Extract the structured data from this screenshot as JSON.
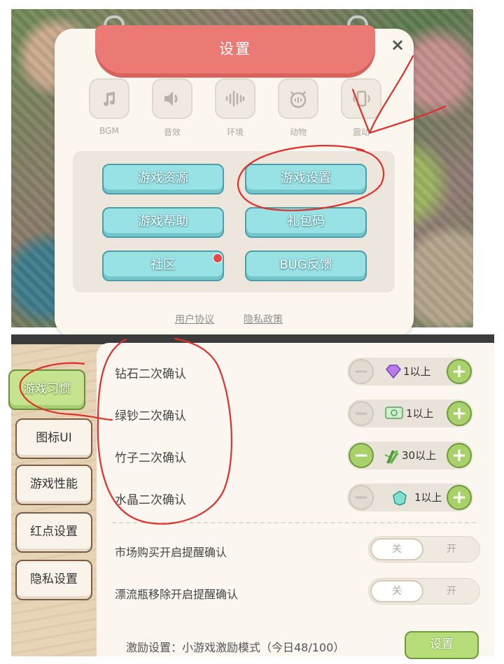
{
  "settings_dialog": {
    "title": "设置",
    "close_label": "×",
    "audio_toggles": [
      {
        "label": "BGM",
        "icon": "music-note-icon"
      },
      {
        "label": "音效",
        "icon": "speaker-icon"
      },
      {
        "label": "环境",
        "icon": "soundwave-icon"
      },
      {
        "label": "动物",
        "icon": "animal-sound-icon"
      },
      {
        "label": "震动",
        "icon": "vibrate-icon"
      }
    ],
    "menu_buttons": {
      "resources": "游戏资源",
      "settings": "游戏设置",
      "help": "游戏帮助",
      "gift_code": "礼包码",
      "community": "社区",
      "bug_feedback": "BUG反馈"
    },
    "footer": {
      "user_agreement": "用户协议",
      "privacy_policy": "隐私政策"
    }
  },
  "game_settings": {
    "sidebar": [
      {
        "label": "游戏习惯",
        "active": true
      },
      {
        "label": "图标UI"
      },
      {
        "label": "游戏性能"
      },
      {
        "label": "红点设置"
      },
      {
        "label": "隐私设置"
      }
    ],
    "confirm_rows": [
      {
        "label": "钻石二次确认",
        "value": "1以上",
        "icon": "diamond-icon"
      },
      {
        "label": "绿钞二次确认",
        "value": "1以上",
        "icon": "green-cash-icon"
      },
      {
        "label": "竹子二次确认",
        "value": "30以上",
        "icon": "bamboo-icon"
      },
      {
        "label": "水晶二次确认",
        "value": "1以上",
        "icon": "crystal-icon"
      }
    ],
    "toggle_rows": [
      {
        "label": "市场购买开启提醒确认",
        "off": "关",
        "on": "开",
        "state": "off"
      },
      {
        "label": "漂流瓶移除开启提醒确认",
        "off": "关",
        "on": "开",
        "state": "off"
      }
    ],
    "incentive": {
      "text": "激励设置：小游戏激励模式（今日48/100）",
      "button": "设置"
    }
  },
  "colors": {
    "ribbon": "#ea7a73",
    "menu_button": "#98e1e4",
    "green_button": "#a9d16a",
    "annotation_red": "#e0302a"
  }
}
